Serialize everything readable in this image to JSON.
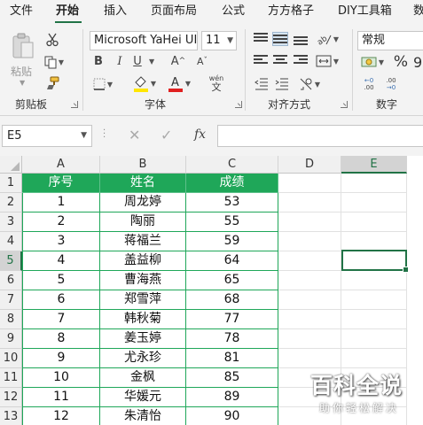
{
  "tabs": [
    "文件",
    "开始",
    "插入",
    "页面布局",
    "公式",
    "方方格子",
    "DIY工具箱",
    "数"
  ],
  "ribbon": {
    "clipboard": {
      "paste_label": "粘贴",
      "group_label": "剪贴板"
    },
    "font": {
      "font_name": "Microsoft YaHei UI",
      "font_size": "11",
      "bold": "B",
      "italic": "I",
      "underline": "U",
      "grow": "A",
      "shrink": "A",
      "phonetic": "wén",
      "group_label": "字体",
      "fill_color": "#ffe600",
      "font_color": "#e02020"
    },
    "alignment": {
      "group_label": "对齐方式"
    },
    "number": {
      "format": "常规",
      "percent": "%",
      "group_label": "数字"
    }
  },
  "formula_bar": {
    "name_box": "E5",
    "fx_label": "fx",
    "content": ""
  },
  "grid": {
    "columns": [
      "A",
      "B",
      "C",
      "D",
      "E"
    ],
    "selected_column": "E",
    "rows": [
      "1",
      "2",
      "3",
      "4",
      "5",
      "6",
      "7",
      "8",
      "9",
      "10",
      "11",
      "12",
      "13"
    ],
    "selected_row": "5",
    "header": [
      "序号",
      "姓名",
      "成绩"
    ],
    "data": [
      [
        "1",
        "周龙婷",
        "53"
      ],
      [
        "2",
        "陶丽",
        "55"
      ],
      [
        "3",
        "蒋福兰",
        "59"
      ],
      [
        "4",
        "盖益柳",
        "64"
      ],
      [
        "5",
        "曹海燕",
        "65"
      ],
      [
        "6",
        "郑雪萍",
        "68"
      ],
      [
        "7",
        "韩秋菊",
        "77"
      ],
      [
        "8",
        "姜玉婷",
        "78"
      ],
      [
        "9",
        "尤永珍",
        "81"
      ],
      [
        "10",
        "金枫",
        "85"
      ],
      [
        "11",
        "华媛元",
        "89"
      ],
      [
        "12",
        "朱清怡",
        "90"
      ]
    ]
  },
  "watermark": {
    "title": "百科全说",
    "subtitle": "助你轻松解决"
  }
}
